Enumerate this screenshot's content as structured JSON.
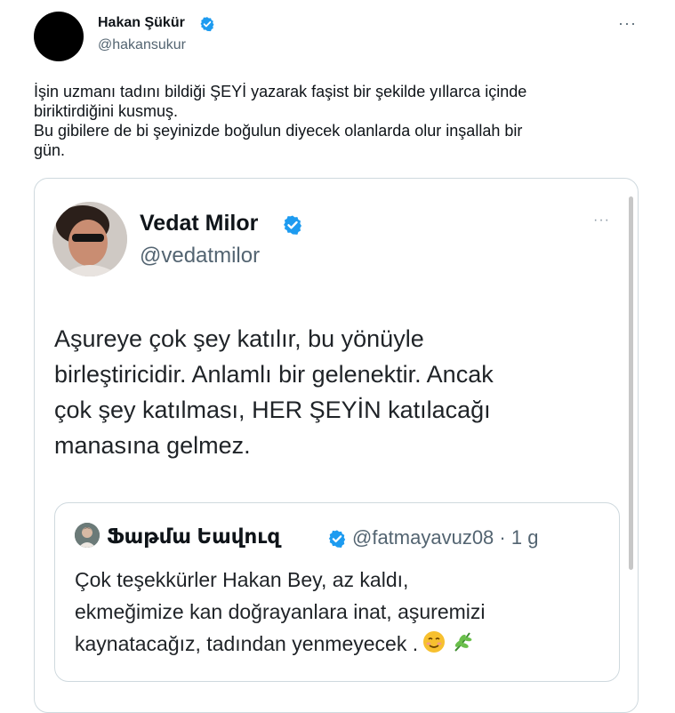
{
  "author": {
    "name": "Hakan Şükür",
    "handle": "@hakansukur",
    "more_label": "···"
  },
  "tweet": {
    "lines": [
      "İşin uzmanı tadını bildiği ŞEYİ yazarak faşist bir şekilde yıllarca içinde",
      "biriktirdiğini kusmuş.",
      "Bu gibilere de bi şeyinizde boğulun diyecek olanlarda olur inşallah bir",
      "gün."
    ]
  },
  "quoted": {
    "name": "Vedat Milor",
    "handle": "@vedatmilor",
    "more_label": "···",
    "lines": [
      "Aşureye çok şey katılır, bu yönüyle",
      "birleştiricidir. Anlamlı bir gelenektir. Ancak",
      "çok şey katılması, HER ŞEYİN katılacağı",
      "manasına gelmez."
    ],
    "inner": {
      "name": "Ֆաթմա Եավուզ",
      "handle_time": "@fatmayavuz08 · 1 g",
      "lines": [
        "Çok teşekkürler Hakan Bey, az kaldı,",
        "ekmeğimize kan doğrayanlara inat, aşuremizi",
        "kaynatacağız, tadından yenmeyecek ."
      ],
      "emojis": [
        "smiling-face-icon",
        "herb-icon"
      ]
    }
  },
  "colors": {
    "verified": "#1d9bf0",
    "muted": "#536471",
    "border": "#cfd9de"
  }
}
